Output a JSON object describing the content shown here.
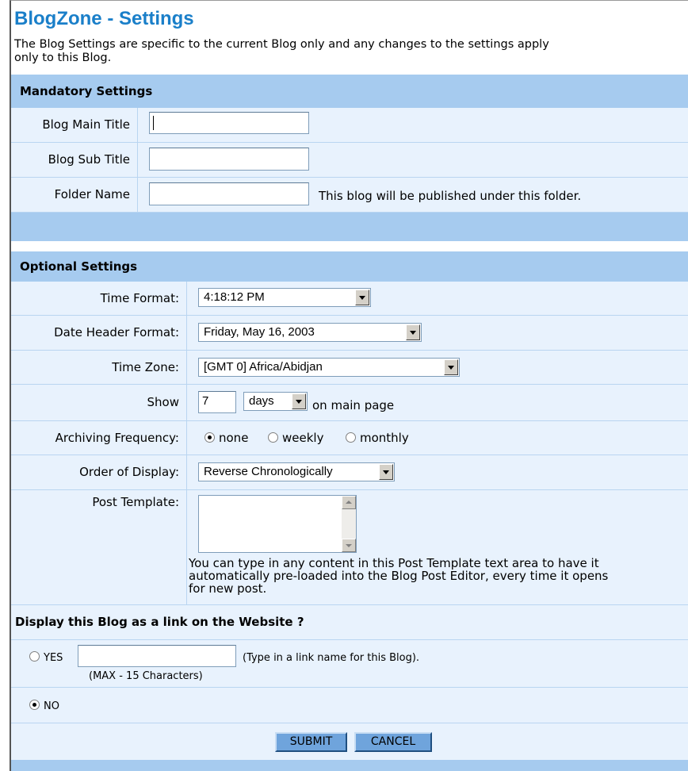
{
  "header": {
    "title": "BlogZone - Settings",
    "intro_line1": "The Blog Settings are specific to the current Blog only and any changes to the settings apply",
    "intro_line2": "only to this Blog."
  },
  "mandatory": {
    "heading": "Mandatory Settings",
    "main_title_label": "Blog Main Title",
    "main_title_value": "",
    "sub_title_label": "Blog Sub Title",
    "sub_title_value": "",
    "folder_label": "Folder Name",
    "folder_value": "",
    "folder_hint": "This blog will be published under this folder."
  },
  "optional": {
    "heading": "Optional Settings",
    "time_format_label": "Time Format:",
    "time_format_value": "4:18:12 PM",
    "date_header_label": "Date Header Format:",
    "date_header_value": "Friday, May 16, 2003",
    "time_zone_label": "Time Zone:",
    "time_zone_value": "[GMT 0] Africa/Abidjan",
    "show_label": "Show",
    "show_count": "7",
    "show_unit": "days",
    "show_suffix": "on main page",
    "archiving_label": "Archiving Frequency:",
    "archiving_options": [
      "none",
      "weekly",
      "monthly"
    ],
    "archiving_selected": "none",
    "order_label": "Order of Display:",
    "order_value": "Reverse Chronologically",
    "post_template_label": "Post Template:",
    "post_template_value": "",
    "post_template_help_1": "You can type in any content in this Post Template text area to have it",
    "post_template_help_2": "automatically pre-loaded into the Blog Post Editor, every time it opens",
    "post_template_help_3": "for new post."
  },
  "link": {
    "heading": "Display this Blog as a link on the Website ?",
    "yes_label": "YES",
    "link_name_value": "",
    "link_hint": "(Type in a link name for this Blog).",
    "max_hint": "(MAX - 15 Characters)",
    "no_label": "NO",
    "selected": "NO"
  },
  "actions": {
    "submit_label": "SUBMIT",
    "cancel_label": "CANCEL"
  },
  "colors": {
    "title": "#1a7fc9",
    "section_band": "#a6cbef",
    "row_bg": "#e8f2fd",
    "button": "#6fa4dc"
  }
}
